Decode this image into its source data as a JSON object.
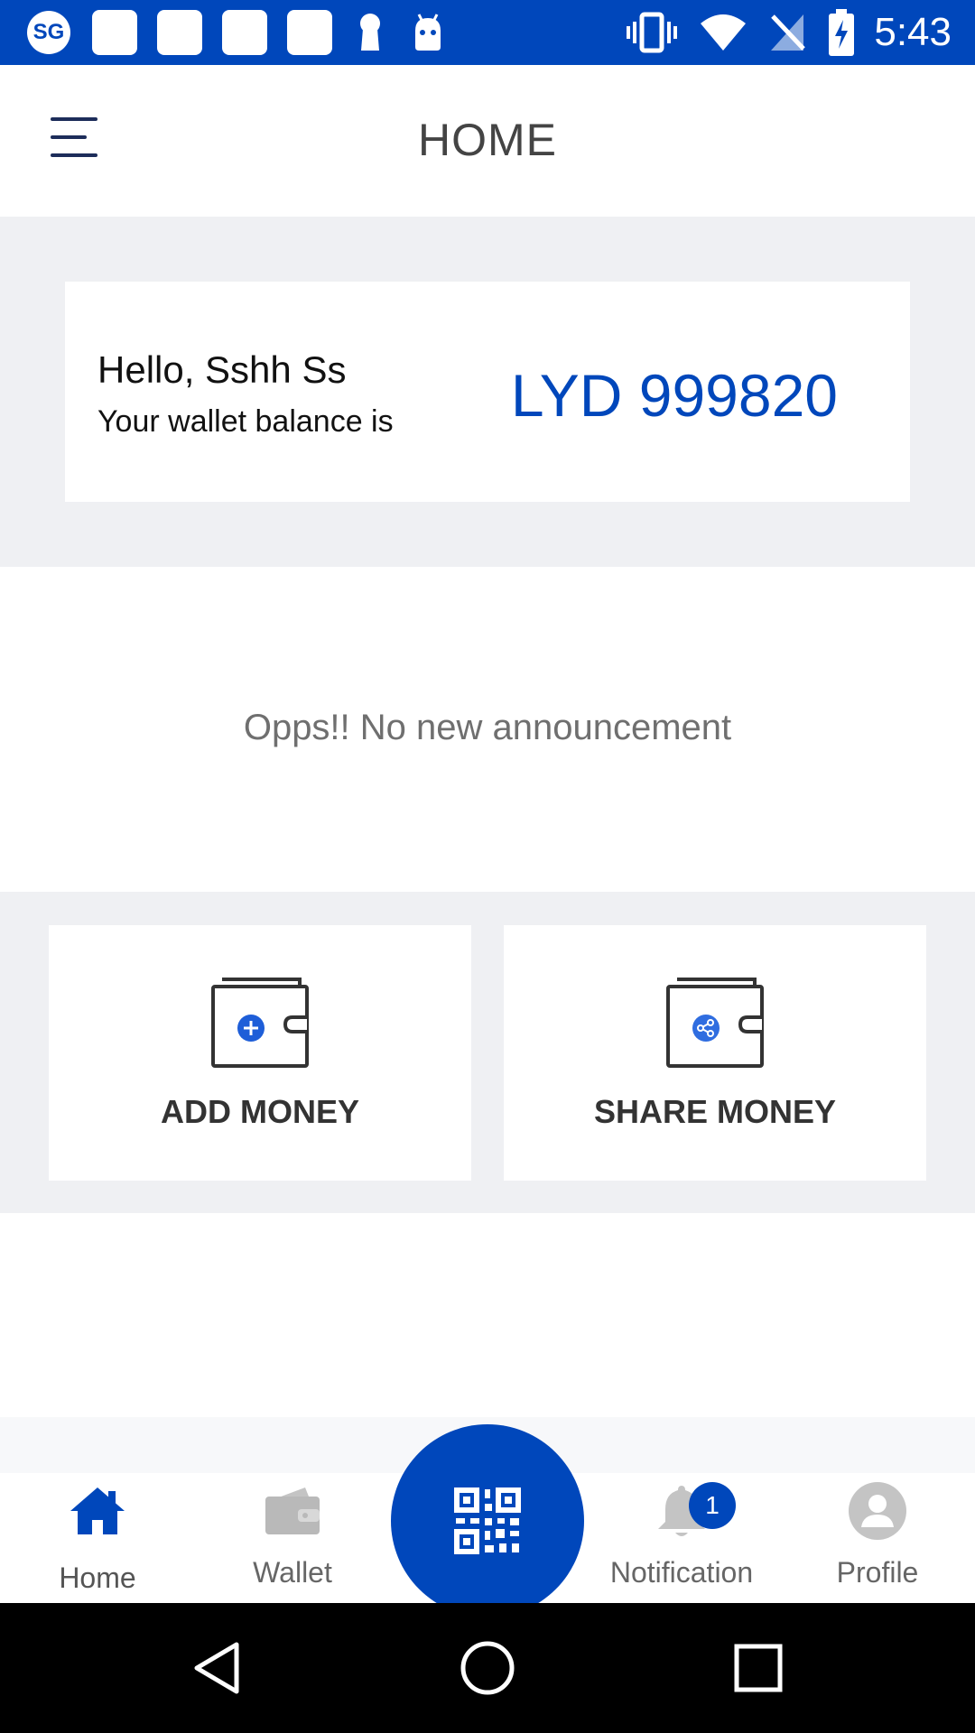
{
  "status_bar": {
    "carrier_icon_text": "SG",
    "time": "5:43",
    "icons": [
      "sg-icon",
      "notification-square-icon",
      "notification-square-icon",
      "notification-square-icon",
      "notification-square-icon",
      "keyhole-icon",
      "android-icon",
      "vibrate-icon",
      "wifi-icon",
      "no-signal-icon",
      "battery-charging-icon"
    ]
  },
  "header": {
    "title": "HOME",
    "menu_icon": "hamburger-menu-icon"
  },
  "balance_card": {
    "greeting": "Hello, Sshh Ss",
    "label": "Your wallet balance is",
    "amount": "LYD 999820"
  },
  "announcement": {
    "message": "Opps!! No new announcement"
  },
  "actions": [
    {
      "label": "ADD MONEY",
      "icon": "wallet-add-icon"
    },
    {
      "label": "SHARE MONEY",
      "icon": "wallet-share-icon"
    }
  ],
  "bottom_nav": {
    "items": [
      {
        "label": "Home",
        "icon": "home-icon",
        "active": true
      },
      {
        "label": "Wallet",
        "icon": "wallet-icon",
        "active": false
      },
      {
        "label": "Notification",
        "icon": "bell-icon",
        "active": false,
        "badge": "1"
      },
      {
        "label": "Profile",
        "icon": "profile-icon",
        "active": false
      }
    ],
    "center_button_icon": "qr-code-icon"
  },
  "system_nav": {
    "buttons": [
      "back-icon",
      "home-circle-icon",
      "recent-apps-icon"
    ]
  },
  "colors": {
    "brand_blue": "#0047bb",
    "section_gray": "#eff0f3",
    "inactive_gray": "#b9b9b9",
    "text_dark": "#333333"
  }
}
